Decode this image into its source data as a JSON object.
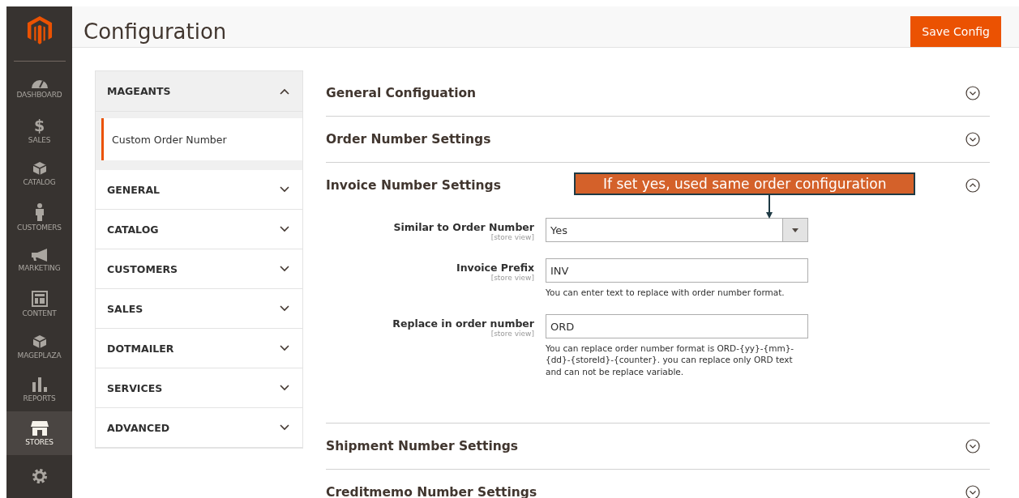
{
  "nav": [
    {
      "kind": "dashboard",
      "label": "DASHBOARD",
      "selected": false
    },
    {
      "kind": "sales",
      "icon": "$",
      "label": "SALES",
      "selected": false
    },
    {
      "kind": "box",
      "label": "CATALOG",
      "selected": false
    },
    {
      "kind": "person",
      "label": "CUSTOMERS",
      "selected": false
    },
    {
      "kind": "megaphone",
      "label": "MARKETING",
      "selected": false
    },
    {
      "kind": "layout",
      "label": "CONTENT",
      "selected": false
    },
    {
      "kind": "box",
      "label": "MAGEPLAZA",
      "selected": false
    },
    {
      "kind": "bars",
      "label": "REPORTS",
      "selected": false
    },
    {
      "kind": "store",
      "label": "STORES",
      "selected": true
    },
    {
      "kind": "gear",
      "selected": false
    }
  ],
  "page": {
    "title": "Configuration",
    "save_button": "Save Config"
  },
  "tabs": [
    {
      "label": "MAGEANTS",
      "expanded": true,
      "children": [
        {
          "label": "Custom Order Number",
          "selected": true
        }
      ]
    },
    {
      "label": "GENERAL",
      "expanded": false
    },
    {
      "label": "CATALOG",
      "expanded": false
    },
    {
      "label": "CUSTOMERS",
      "expanded": false
    },
    {
      "label": "SALES",
      "expanded": false
    },
    {
      "label": "DOTMAILER",
      "expanded": false
    },
    {
      "label": "SERVICES",
      "expanded": false
    },
    {
      "label": "ADVANCED",
      "expanded": false
    }
  ],
  "sections": [
    {
      "title": "General Configuation",
      "expanded": false
    },
    {
      "title": "Order Number Settings",
      "expanded": false
    },
    {
      "title": "Invoice Number Settings",
      "expanded": true,
      "callout": "If set yes, used same order configuration",
      "fields": [
        {
          "kind": "select",
          "label": "Similar to Order Number",
          "scope": "[store view]",
          "value": "Yes"
        },
        {
          "kind": "text",
          "label": "Invoice Prefix",
          "scope": "[store view]",
          "value": "INV",
          "note": "You can enter text to replace with order number format."
        },
        {
          "kind": "text",
          "label": "Replace in order number",
          "scope": "[store view]",
          "value": "ORD",
          "note": "You can replace order number format is ORD-{yy}-{mm}-{dd}-{storeId}-{counter}. you can replace only ORD text and can not be replace variable."
        }
      ]
    },
    {
      "title": "Shipment Number Settings",
      "expanded": false
    },
    {
      "title": "Creditmemo Number Settings",
      "expanded": false
    }
  ]
}
